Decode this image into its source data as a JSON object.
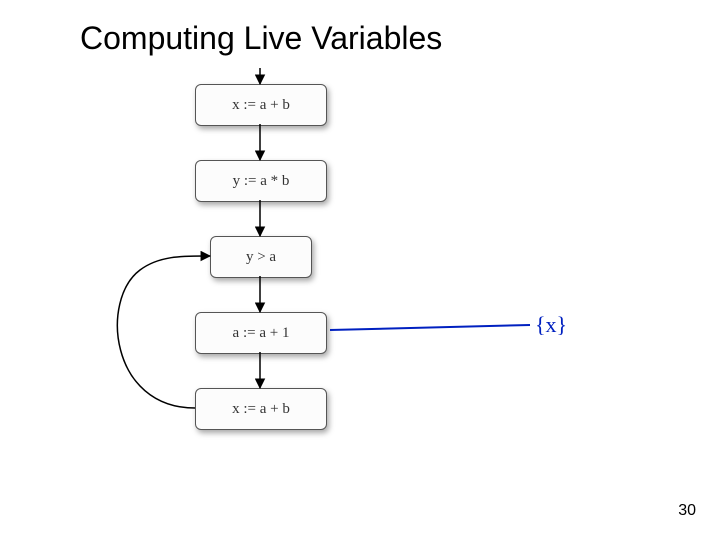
{
  "title": "Computing Live Variables",
  "nodes": {
    "n1": "x := a + b",
    "n2": "y := a * b",
    "n3": "y > a",
    "n4": "a := a + 1",
    "n5": "x := a + b"
  },
  "annotation": "{x}",
  "page_number": "30"
}
